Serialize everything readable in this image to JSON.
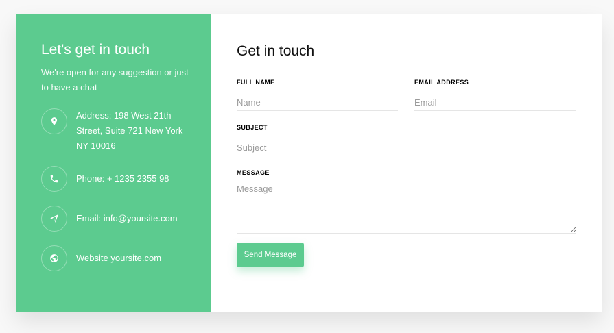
{
  "info": {
    "title": "Let's get in touch",
    "subtitle": "We're open for any suggestion or just to have a chat",
    "items": [
      {
        "icon": "map-marker-icon",
        "key": "Address:",
        "value": " 198 West 21th Street, Suite 721 New York NY 10016"
      },
      {
        "icon": "phone-icon",
        "key": "Phone:",
        "value": " + 1235 2355 98"
      },
      {
        "icon": "paper-plane-icon",
        "key": "Email:",
        "value": " info@yoursite.com"
      },
      {
        "icon": "globe-icon",
        "key": "Website",
        "value": " yoursite.com"
      }
    ]
  },
  "form": {
    "title": "Get in touch",
    "full_name": {
      "label": "Full Name",
      "placeholder": "Name",
      "value": ""
    },
    "email": {
      "label": "Email Address",
      "placeholder": "Email",
      "value": ""
    },
    "subject": {
      "label": "Subject",
      "placeholder": "Subject",
      "value": ""
    },
    "message": {
      "label": "Message",
      "placeholder": "Message",
      "value": ""
    },
    "submit_label": "Send Message"
  },
  "colors": {
    "accent": "#5ccb8f",
    "background": "#f8f8f8",
    "card": "#ffffff"
  }
}
